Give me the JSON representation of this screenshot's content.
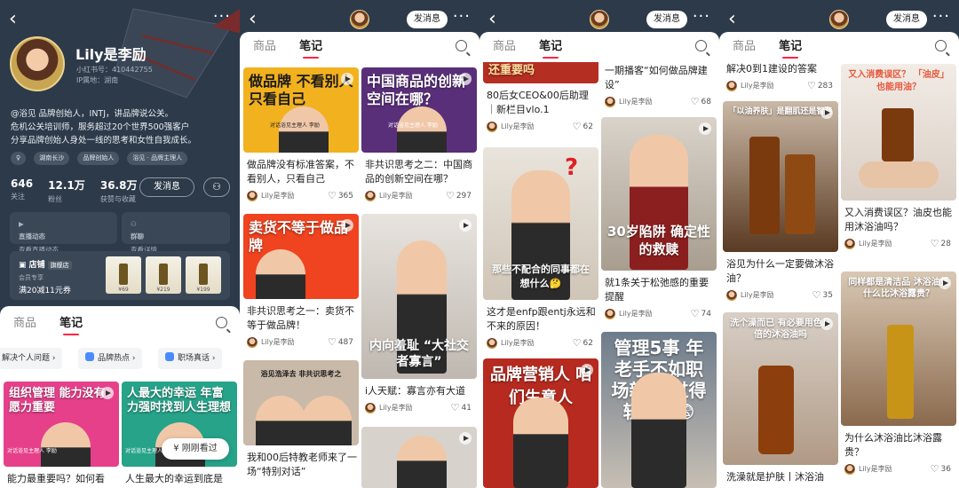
{
  "profile": {
    "name": "Lily是李励",
    "rednote_id": "小红书号：410442755",
    "ip": "IP属地：湖南",
    "bio": [
      "@浴见 品牌创始人，INTJ，讲品牌说公关。",
      "危机公关培训师，服务超过20个世界500强客户",
      "分享品牌创始人身处一线的思考和女性自我成长。"
    ],
    "chips": [
      "湖南长沙",
      "品牌创始人",
      "浴见 · 品牌主理人"
    ],
    "stats": [
      {
        "value": "646",
        "label": "关注"
      },
      {
        "value": "12.1万",
        "label": "粉丝"
      },
      {
        "value": "36.8万",
        "label": "获赞与收藏"
      }
    ],
    "message_button": "发消息",
    "live": {
      "title": "直播动态",
      "sub": "查看直播动态"
    },
    "group": {
      "title": "群聊",
      "sub": "查看详情"
    },
    "shop": {
      "title": "店铺",
      "tag": "旗舰店",
      "sub1": "会员专享",
      "sub2": "满20减11元券",
      "prices": [
        "¥69",
        "¥219",
        "¥199"
      ]
    },
    "tabs": [
      "商品",
      "笔记"
    ],
    "pills": [
      "解决个人问题",
      "品牌热点",
      "职场真话"
    ],
    "notes": [
      {
        "overlay": "组织管理 能力没有愿力重要",
        "sub": "对话浴见主理人 李励",
        "title": "能力最重要吗？如何看"
      },
      {
        "overlay": "人最大的幸运 年富力强时找到人生理想",
        "sub": "对话浴见主理人 李励",
        "title": "人生最大的幸运到底是"
      }
    ],
    "toast": "刚刚看过"
  },
  "header": {
    "message_button": "发消息",
    "more": "···",
    "back": "‹"
  },
  "tabs": [
    "商品",
    "笔记"
  ],
  "author": "Lily是李励",
  "panel2": {
    "left": [
      {
        "overlay": "做品牌 不看别人 只看自己",
        "sub": "对话浴见主理人 李励",
        "title": "做品牌没有标准答案，不看别人，只看自己",
        "likes": "365"
      },
      {
        "overlay": "卖货不等于做品牌",
        "sub": "",
        "title": "非共识思考之一：卖货不等于做品牌！",
        "likes": "487"
      },
      {
        "overlay": "浴见浩泽去 非共识思考之",
        "sub": "",
        "title": "我和00后特教老师来了一场“特别对话”",
        "likes": ""
      }
    ],
    "right": [
      {
        "overlay": "中国商品的创新空间在哪？",
        "sub": "对话浴见主理人 李励",
        "title": "非共识思考之二：中国商品的创新空间在哪？",
        "likes": "297"
      },
      {
        "overlay": "内向羞耻 “大社交者寡言”",
        "sub": "",
        "title": "i人天赋：寡言亦有大道",
        "likes": "41"
      },
      {
        "overlay": "",
        "sub": "",
        "title": "",
        "likes": ""
      }
    ]
  },
  "panel3": {
    "left": [
      {
        "overlay": "还重要吗",
        "title": "80后女CEO&00后助理｜新栏目vlo.1",
        "likes": "62"
      },
      {
        "overlay": "那些不配合的同事都在想什么🤔",
        "title": "这才是enfp跟entj永远和不来的原因！",
        "likes": "62"
      },
      {
        "overlay": "品牌营销人 咱们生意人",
        "title": "",
        "likes": ""
      }
    ],
    "right": [
      {
        "overlay": "",
        "title": "一期播客“如何做品牌建设”",
        "likes": "68"
      },
      {
        "overlay": "30岁陷阱 确定性的救赎",
        "title": "就1条关于松弛感的重要提醒",
        "likes": "74"
      },
      {
        "overlay": "管理5事 年老手不如职场新人 过得轻松？😨",
        "title": "",
        "likes": ""
      }
    ]
  },
  "panel4": {
    "left": [
      {
        "overlay": "",
        "title": "",
        "likes": "283",
        "partial": "解决0到1建设的答案"
      },
      {
        "overlay": "「以油养肤」是翻肌还是智商",
        "title": "浴见为什么一定要做沐浴油？",
        "likes": "35"
      },
      {
        "overlay": "洗个澡而已 有必要用色几倍的沐浴油吗",
        "title": "洗澡就是护肤丨沐浴油",
        "likes": ""
      }
    ],
    "right": [
      {
        "overlay": "又入消费误区？ 「油皮」也能用油？",
        "title": "又入消费误区？油皮也能用沐浴油吗？",
        "likes": "28"
      },
      {
        "overlay": "同样都是清洁品 沐浴油凭什么比沐浴露贵？",
        "title": "为什么沐浴油比沐浴露贵？",
        "likes": "36"
      }
    ]
  }
}
